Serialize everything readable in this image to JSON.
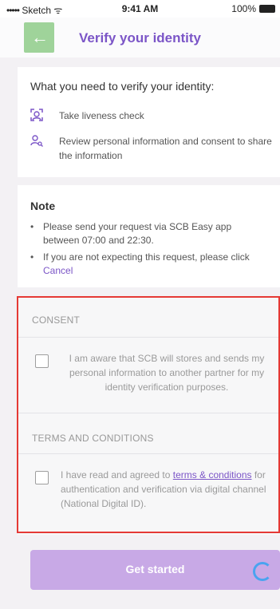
{
  "status_bar": {
    "signal": "•••••",
    "carrier": "Sketch",
    "wifi": "ᯤ",
    "time": "9:41 AM",
    "battery_pct": "100%"
  },
  "header": {
    "back_icon": "←",
    "title": "Verify your identity"
  },
  "verify": {
    "heading": "What you need to verify your identity:",
    "items": [
      {
        "icon": "liveness-icon",
        "text": "Take liveness check"
      },
      {
        "icon": "person-search-icon",
        "text": "Review personal information and consent to share the information"
      }
    ]
  },
  "note": {
    "heading": "Note",
    "items": [
      {
        "text": "Please send your request via SCB Easy app between 07:00 and 22:30."
      },
      {
        "text_before": "If you are not expecting this request, please click ",
        "link": "Cancel"
      }
    ]
  },
  "consent": {
    "header": "CONSENT",
    "text": "I am aware that SCB will stores and sends my personal information to another partner for my identity verification purposes."
  },
  "terms": {
    "header": "TERMS AND CONDITIONS",
    "text_before": "I have read and agreed to ",
    "link": "terms & conditions",
    "text_after": " for authentication and verification via digital channel (National Digital ID)."
  },
  "cta": {
    "label": "Get started"
  },
  "colors": {
    "accent": "#7b55c7",
    "back_button": "#9fd39a",
    "cta_disabled": "#c8a9e6",
    "highlight": "#e53935"
  }
}
